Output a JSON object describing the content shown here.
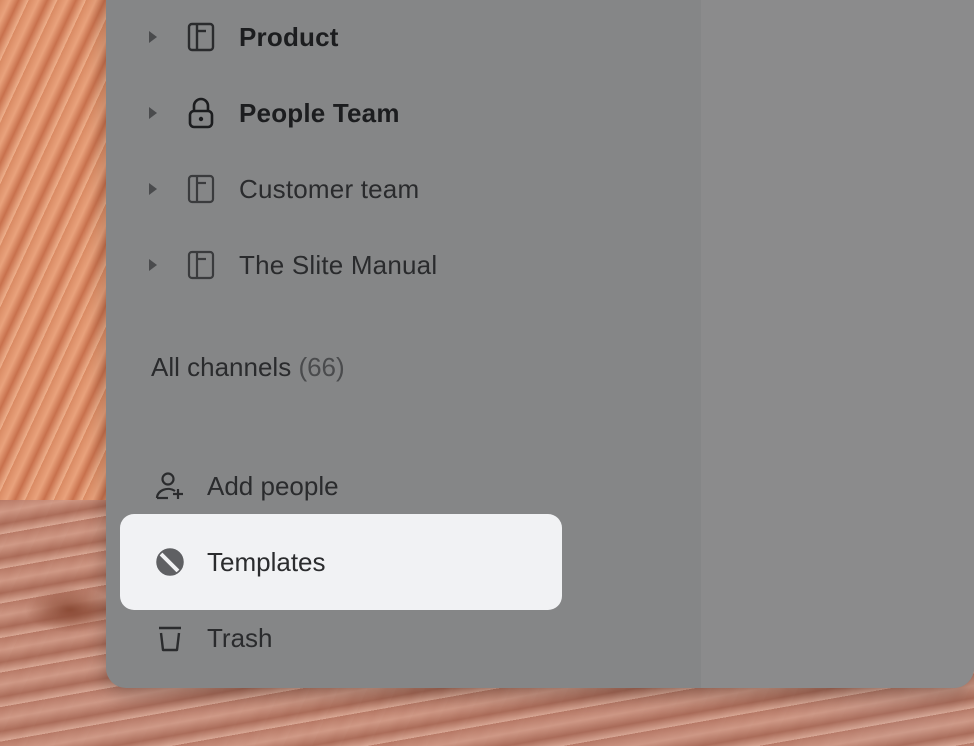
{
  "sidebar": {
    "channels": [
      {
        "label": "Product",
        "icon": "notebook-icon",
        "bold": true
      },
      {
        "label": "People Team",
        "icon": "lock-icon",
        "bold": true
      },
      {
        "label": "Customer team",
        "icon": "notebook-icon",
        "bold": false
      },
      {
        "label": "The Slite Manual",
        "icon": "notebook-icon",
        "bold": false
      }
    ],
    "all_channels": {
      "label": "All channels",
      "count": "(66)"
    },
    "actions": [
      {
        "label": "Add people",
        "icon": "add-person-icon"
      },
      {
        "label": "Templates",
        "icon": "templates-icon",
        "highlighted": true
      },
      {
        "label": "Trash",
        "icon": "trash-icon"
      }
    ]
  },
  "colors": {
    "panel": "#858687",
    "highlight": "#f1f2f4",
    "text": "#2a2b2d"
  }
}
